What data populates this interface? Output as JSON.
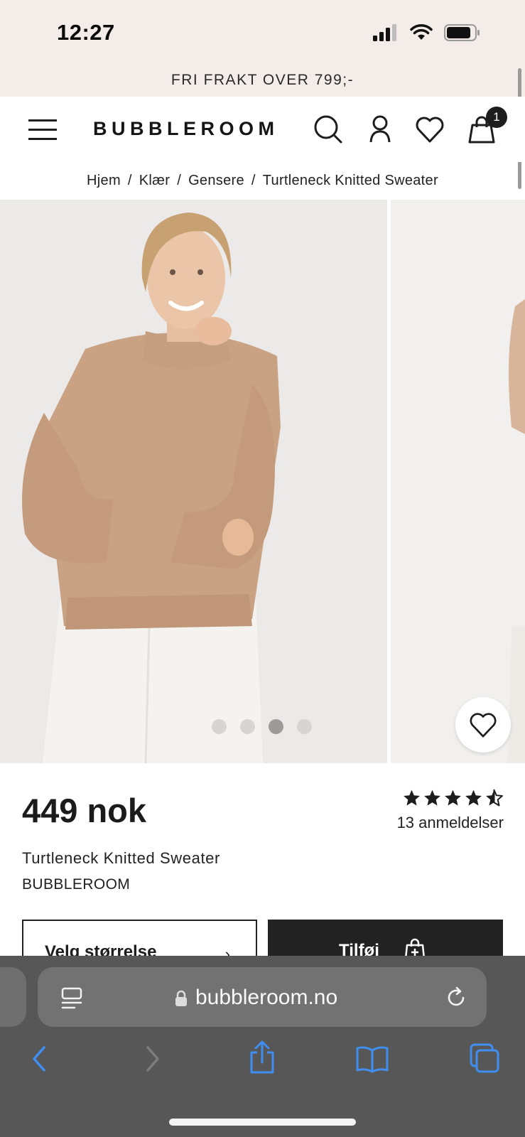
{
  "status_bar": {
    "time": "12:27"
  },
  "promo": {
    "text": "FRI FRAKT OVER 799;-"
  },
  "header": {
    "logo": "BUBBLEROOM",
    "cart_count": "1"
  },
  "breadcrumb": {
    "items": [
      "Hjem",
      "Klær",
      "Gensere",
      "Turtleneck Knitted Sweater"
    ]
  },
  "gallery": {
    "image_count": 4,
    "active_index": 2
  },
  "product": {
    "price": "449 nok",
    "rating": 4.5,
    "reviews": "13 anmeldelser",
    "name": "Turtleneck Knitted Sweater",
    "brand": "BUBBLEROOM",
    "size_button": "Velg størrelse",
    "add_button": "Tilføj"
  },
  "browser": {
    "url": "bubbleroom.no"
  },
  "colors": {
    "promo_bg": "#f4ece8",
    "dark": "#222222",
    "safari_bg": "#575757",
    "safari_blue": "#3f8ef0"
  }
}
